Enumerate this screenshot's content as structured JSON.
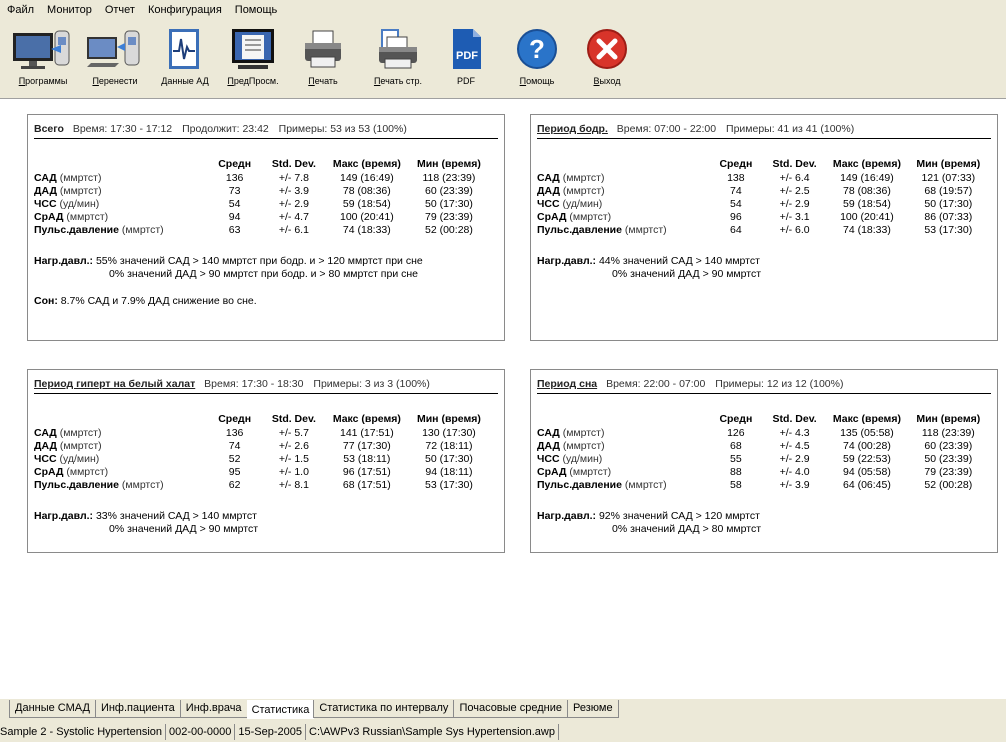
{
  "menu": [
    "Файл",
    "Монитор",
    "Отчет",
    "Конфигурация",
    "Помощь"
  ],
  "toolbar": {
    "programs": "Программы",
    "transfer": "Перенести",
    "bp_data": "Данные АД",
    "preview": "ПредПросм.",
    "print": "Печать",
    "print_page": "Печать стр.",
    "pdf": "PDF",
    "help": "Помощь",
    "exit": "Выход",
    "pdf_icon_text": "PDF"
  },
  "columns": {
    "param": "",
    "mean": "Средн",
    "std": "Std. Dev.",
    "max": "Макс (время)",
    "min": "Мин (время)"
  },
  "panels": [
    {
      "title": "Всего",
      "time": "Время: 17:30 - 17:12",
      "extra": "Продолжит: 23:42",
      "samples": "Примеры: 53 из 53 (100%)",
      "rows": [
        {
          "name": "САД",
          "unit": "(ммртст)",
          "mean": "136",
          "std": "+/- 7.8",
          "max": "149 (16:49)",
          "min": "118 (23:39)"
        },
        {
          "name": "ДАД",
          "unit": "(ммртст)",
          "mean": "73",
          "std": "+/- 3.9",
          "max": "78 (08:36)",
          "min": "60 (23:39)"
        },
        {
          "name": "ЧСС",
          "unit": "(уд/мин)",
          "mean": "54",
          "std": "+/- 2.9",
          "max": "59 (18:54)",
          "min": "50 (17:30)"
        },
        {
          "name": "СрАД",
          "unit": "(ммртст)",
          "mean": "94",
          "std": "+/- 4.7",
          "max": "100 (20:41)",
          "min": "79 (23:39)"
        },
        {
          "name": "Пульс.давление",
          "unit": "(ммртст)",
          "mean": "63",
          "std": "+/- 6.1",
          "max": "74 (18:33)",
          "min": "52 (00:28)"
        }
      ],
      "load_label": "Нагр.давл.:",
      "load_1": "55% значений САД > 140 ммртст при бодр. и > 120 ммртст при сне",
      "load_2": "0% значений ДАД > 90 ммртст при бодр. и > 80 ммртст при сне",
      "sleep_label": "Сон:",
      "sleep_text": "8.7% САД и 7.9% ДАД снижение во сне."
    },
    {
      "title": "Период бодр.",
      "time": "Время: 07:00 - 22:00",
      "extra": "",
      "samples": "Примеры: 41 из 41 (100%)",
      "rows": [
        {
          "name": "САД",
          "unit": "(ммртст)",
          "mean": "138",
          "std": "+/- 6.4",
          "max": "149 (16:49)",
          "min": "121 (07:33)"
        },
        {
          "name": "ДАД",
          "unit": "(ммртст)",
          "mean": "74",
          "std": "+/- 2.5",
          "max": "78 (08:36)",
          "min": "68 (19:57)"
        },
        {
          "name": "ЧСС",
          "unit": "(уд/мин)",
          "mean": "54",
          "std": "+/- 2.9",
          "max": "59 (18:54)",
          "min": "50 (17:30)"
        },
        {
          "name": "СрАД",
          "unit": "(ммртст)",
          "mean": "96",
          "std": "+/- 3.1",
          "max": "100 (20:41)",
          "min": "86 (07:33)"
        },
        {
          "name": "Пульс.давление",
          "unit": "(ммртст)",
          "mean": "64",
          "std": "+/- 6.0",
          "max": "74 (18:33)",
          "min": "53 (17:30)"
        }
      ],
      "load_label": "Нагр.давл.:",
      "load_1": "44% значений САД > 140 ммртст",
      "load_2": "0% значений ДАД > 90 ммртст"
    },
    {
      "title": "Период гиперт на белый халат",
      "time": "Время: 17:30 - 18:30",
      "extra": "",
      "samples": "Примеры: 3 из 3 (100%)",
      "rows": [
        {
          "name": "САД",
          "unit": "(ммртст)",
          "mean": "136",
          "std": "+/- 5.7",
          "max": "141 (17:51)",
          "min": "130 (17:30)"
        },
        {
          "name": "ДАД",
          "unit": "(ммртст)",
          "mean": "74",
          "std": "+/- 2.6",
          "max": "77 (17:30)",
          "min": "72 (18:11)"
        },
        {
          "name": "ЧСС",
          "unit": "(уд/мин)",
          "mean": "52",
          "std": "+/- 1.5",
          "max": "53 (18:11)",
          "min": "50 (17:30)"
        },
        {
          "name": "СрАД",
          "unit": "(ммртст)",
          "mean": "95",
          "std": "+/- 1.0",
          "max": "96 (17:51)",
          "min": "94 (18:11)"
        },
        {
          "name": "Пульс.давление",
          "unit": "(ммртст)",
          "mean": "62",
          "std": "+/- 8.1",
          "max": "68 (17:51)",
          "min": "53 (17:30)"
        }
      ],
      "load_label": "Нагр.давл.:",
      "load_1": "33% значений САД > 140 ммртст",
      "load_2": "0% значений ДАД > 90 ммртст"
    },
    {
      "title": "Период сна",
      "time": "Время: 22:00 - 07:00",
      "extra": "",
      "samples": "Примеры: 12 из 12 (100%)",
      "rows": [
        {
          "name": "САД",
          "unit": "(ммртст)",
          "mean": "126",
          "std": "+/- 4.3",
          "max": "135 (05:58)",
          "min": "118 (23:39)"
        },
        {
          "name": "ДАД",
          "unit": "(ммртст)",
          "mean": "68",
          "std": "+/- 4.5",
          "max": "74 (00:28)",
          "min": "60 (23:39)"
        },
        {
          "name": "ЧСС",
          "unit": "(уд/мин)",
          "mean": "55",
          "std": "+/- 2.9",
          "max": "59 (22:53)",
          "min": "50 (23:39)"
        },
        {
          "name": "СрАД",
          "unit": "(ммртст)",
          "mean": "88",
          "std": "+/- 4.0",
          "max": "94 (05:58)",
          "min": "79 (23:39)"
        },
        {
          "name": "Пульс.давление",
          "unit": "(ммртст)",
          "mean": "58",
          "std": "+/- 3.9",
          "max": "64 (06:45)",
          "min": "52 (00:28)"
        }
      ],
      "load_label": "Нагр.давл.:",
      "load_1": "92% значений САД > 120 ммртст",
      "load_2": "0% значений ДАД > 80 ммртст"
    }
  ],
  "tabs": [
    "Данные СМАД",
    "Инф.пациента",
    "Инф.врача",
    "Статистика",
    "Статистика по интервалу",
    "Почасовые средние",
    "Резюме"
  ],
  "active_tab": "Статистика",
  "status": [
    "Sample 2 - Systolic Hypertension",
    "002-00-0000",
    "15-Sep-2005",
    "C:\\AWPv3 Russian\\Sample Sys Hypertension.awp"
  ],
  "colors": {
    "help": "#2a74c9",
    "exit": "#d8342a",
    "pdf": "#1e5cb3"
  }
}
